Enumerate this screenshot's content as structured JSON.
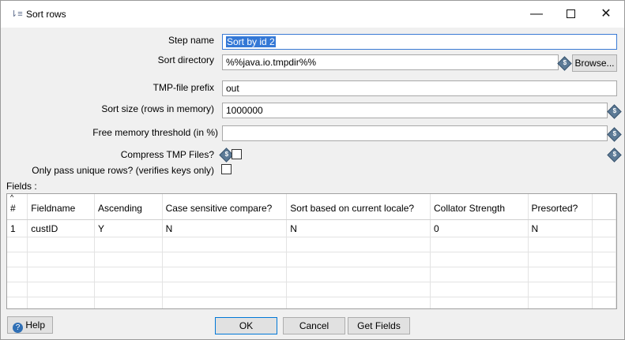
{
  "window": {
    "title": "Sort rows",
    "min_label": "—",
    "max_label": "☐",
    "close_label": "✕"
  },
  "form": {
    "step_name_label": "Step name",
    "step_name_value": "Sort by id 2",
    "sort_dir_label": "Sort directory",
    "sort_dir_value": "%%java.io.tmpdir%%",
    "browse_label": "Browse...",
    "prefix_label": "TMP-file prefix",
    "prefix_value": "out",
    "sort_size_label": "Sort size (rows in memory)",
    "sort_size_value": "1000000",
    "free_mem_label": "Free memory threshold (in %)",
    "free_mem_value": "",
    "compress_label": "Compress TMP Files?",
    "compress_checked": false,
    "unique_label": "Only pass unique rows? (verifies keys only)",
    "unique_checked": false
  },
  "fields": {
    "label": "Fields :",
    "columns": [
      "#",
      "Fieldname",
      "Ascending",
      "Case sensitive compare?",
      "Sort based on current locale?",
      "Collator Strength",
      "Presorted?"
    ],
    "rows": [
      [
        "1",
        "custID",
        "Y",
        "N",
        "N",
        "0",
        "N"
      ]
    ]
  },
  "buttons": {
    "help": "Help",
    "ok": "OK",
    "cancel": "Cancel",
    "get_fields": "Get Fields"
  },
  "icons": {
    "variable": "$",
    "help": "?"
  }
}
